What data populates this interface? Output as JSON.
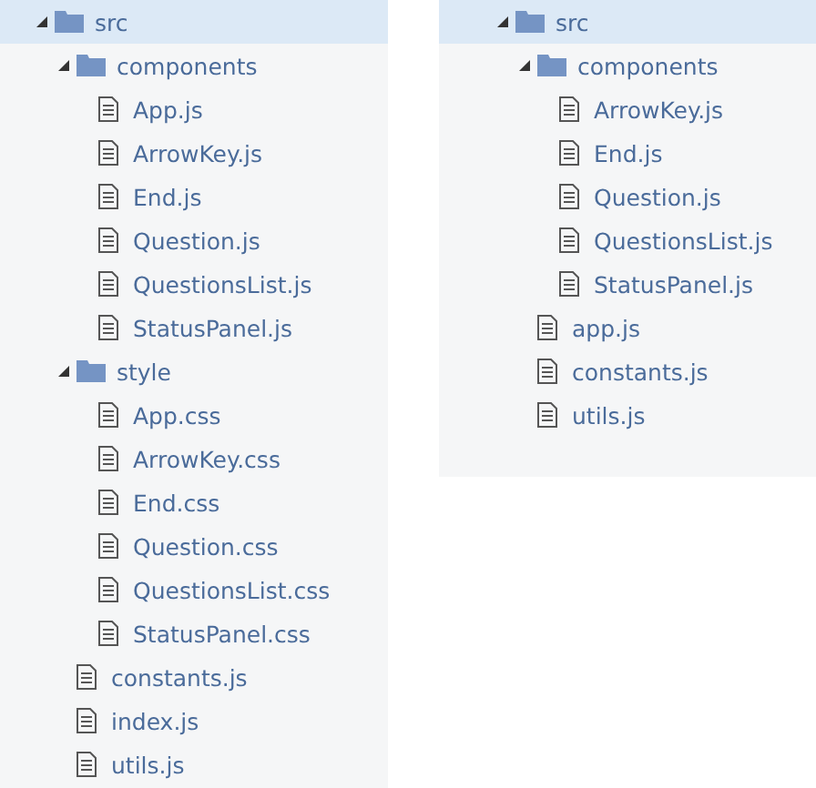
{
  "panels": [
    {
      "tree": [
        {
          "label": "src",
          "kind": "folder",
          "expanded": true,
          "selected": true,
          "children": [
            {
              "label": "components",
              "kind": "folder",
              "expanded": true,
              "selected": false,
              "children": [
                {
                  "label": "App.js",
                  "kind": "file",
                  "selected": false
                },
                {
                  "label": "ArrowKey.js",
                  "kind": "file",
                  "selected": false
                },
                {
                  "label": "End.js",
                  "kind": "file",
                  "selected": false
                },
                {
                  "label": "Question.js",
                  "kind": "file",
                  "selected": false
                },
                {
                  "label": "QuestionsList.js",
                  "kind": "file",
                  "selected": false
                },
                {
                  "label": "StatusPanel.js",
                  "kind": "file",
                  "selected": false
                }
              ]
            },
            {
              "label": "style",
              "kind": "folder",
              "expanded": true,
              "selected": false,
              "children": [
                {
                  "label": "App.css",
                  "kind": "file",
                  "selected": false
                },
                {
                  "label": "ArrowKey.css",
                  "kind": "file",
                  "selected": false
                },
                {
                  "label": "End.css",
                  "kind": "file",
                  "selected": false
                },
                {
                  "label": "Question.css",
                  "kind": "file",
                  "selected": false
                },
                {
                  "label": "QuestionsList.css",
                  "kind": "file",
                  "selected": false
                },
                {
                  "label": "StatusPanel.css",
                  "kind": "file",
                  "selected": false
                }
              ]
            },
            {
              "label": "constants.js",
              "kind": "file",
              "selected": false
            },
            {
              "label": "index.js",
              "kind": "file",
              "selected": false
            },
            {
              "label": "utils.js",
              "kind": "file",
              "selected": false
            }
          ]
        }
      ]
    },
    {
      "tree": [
        {
          "label": "src",
          "kind": "folder",
          "expanded": true,
          "selected": true,
          "children": [
            {
              "label": "components",
              "kind": "folder",
              "expanded": true,
              "selected": false,
              "children": [
                {
                  "label": "ArrowKey.js",
                  "kind": "file",
                  "selected": false
                },
                {
                  "label": "End.js",
                  "kind": "file",
                  "selected": false
                },
                {
                  "label": "Question.js",
                  "kind": "file",
                  "selected": false
                },
                {
                  "label": "QuestionsList.js",
                  "kind": "file",
                  "selected": false
                },
                {
                  "label": "StatusPanel.js",
                  "kind": "file",
                  "selected": false
                }
              ]
            },
            {
              "label": "app.js",
              "kind": "file",
              "selected": false
            },
            {
              "label": "constants.js",
              "kind": "file",
              "selected": false
            },
            {
              "label": "utils.js",
              "kind": "file",
              "selected": false
            }
          ]
        }
      ]
    }
  ]
}
